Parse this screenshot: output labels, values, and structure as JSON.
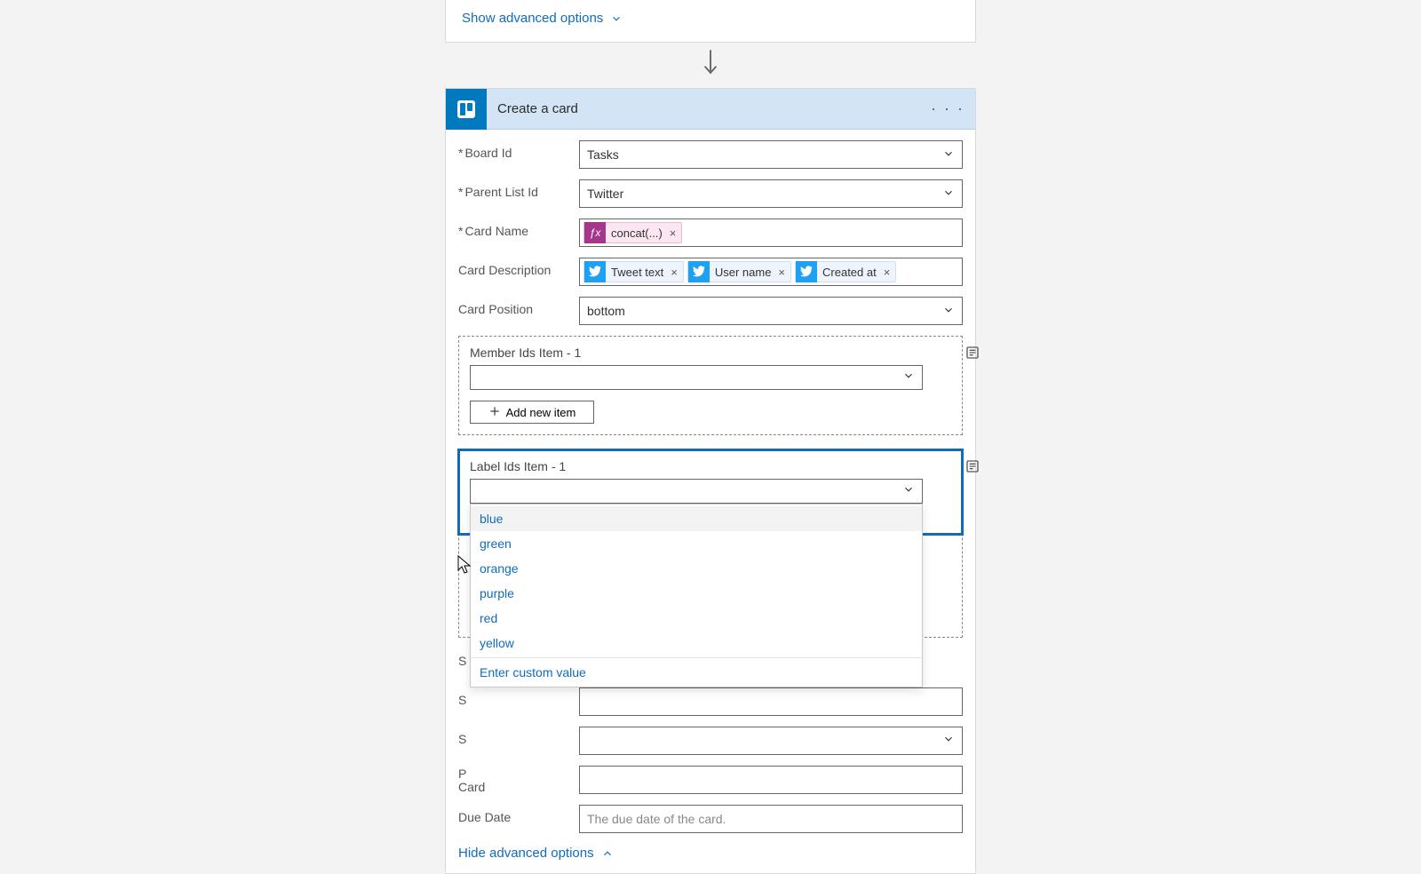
{
  "top": {
    "show_advanced": "Show advanced options"
  },
  "action": {
    "title": "Create a card",
    "menu_label": "· · ·"
  },
  "fields": {
    "board_id": {
      "label": "Board Id",
      "value": "Tasks"
    },
    "parent_list": {
      "label": "Parent List Id",
      "value": "Twitter"
    },
    "card_name": {
      "label": "Card Name"
    },
    "card_desc": {
      "label": "Card Description"
    },
    "card_pos": {
      "label": "Card Position",
      "value": "bottom"
    },
    "member_block": {
      "label": "Member Ids Item - 1",
      "add": "Add new item"
    },
    "label_block": {
      "label": "Label Ids Item - 1"
    },
    "stub1": "S",
    "stub2": "S",
    "stub3": "S",
    "pcard": "P",
    "pcard_line2": "Card",
    "due": {
      "label": "Due Date",
      "placeholder": "The due date of the card."
    }
  },
  "tokens": {
    "concat": "concat(...)",
    "tweet": "Tweet text",
    "user": "User name",
    "created": "Created at"
  },
  "dropdown_options": [
    "blue",
    "green",
    "orange",
    "purple",
    "red",
    "yellow"
  ],
  "dropdown_custom": "Enter custom value",
  "hide_advanced": "Hide advanced options",
  "chart_data": null
}
